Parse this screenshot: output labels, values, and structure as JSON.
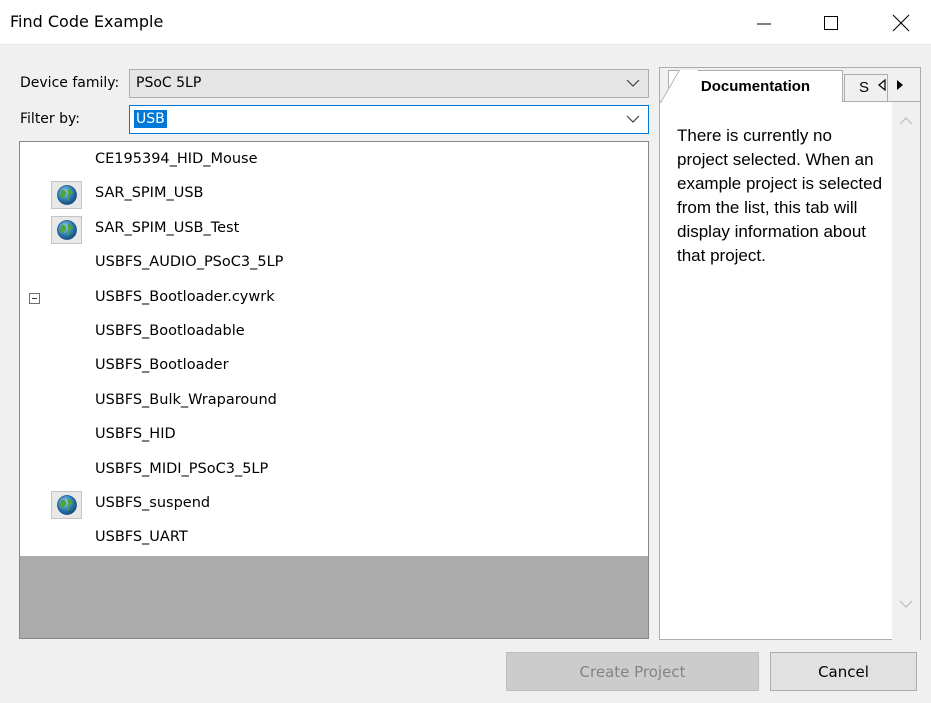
{
  "window": {
    "title": "Find Code Example"
  },
  "device_family": {
    "label": "Device family:",
    "value": "PSoC 5LP"
  },
  "filter": {
    "label": "Filter by:",
    "value": "USB"
  },
  "examples": [
    {
      "name": "CE195394_HID_Mouse",
      "globe": false,
      "expander": false
    },
    {
      "name": "SAR_SPIM_USB",
      "globe": true,
      "expander": false
    },
    {
      "name": "SAR_SPIM_USB_Test",
      "globe": true,
      "expander": false
    },
    {
      "name": "USBFS_AUDIO_PSoC3_5LP",
      "globe": false,
      "expander": false
    },
    {
      "name": "USBFS_Bootloader.cywrk",
      "globe": false,
      "expander": true
    },
    {
      "name": "USBFS_Bootloadable",
      "globe": false,
      "expander": false
    },
    {
      "name": "USBFS_Bootloader",
      "globe": false,
      "expander": false
    },
    {
      "name": "USBFS_Bulk_Wraparound",
      "globe": false,
      "expander": false
    },
    {
      "name": "USBFS_HID",
      "globe": false,
      "expander": false
    },
    {
      "name": "USBFS_MIDI_PSoC3_5LP",
      "globe": false,
      "expander": false
    },
    {
      "name": "USBFS_suspend",
      "globe": true,
      "expander": false
    },
    {
      "name": "USBFS_UART",
      "globe": false,
      "expander": false
    }
  ],
  "doc_panel": {
    "tab_documentation": "Documentation",
    "tab_second": "S",
    "text": "There is currently no project selected. When an example project is selected from the list, this tab will display information about that project."
  },
  "buttons": {
    "create": "Create Project",
    "cancel": "Cancel"
  }
}
